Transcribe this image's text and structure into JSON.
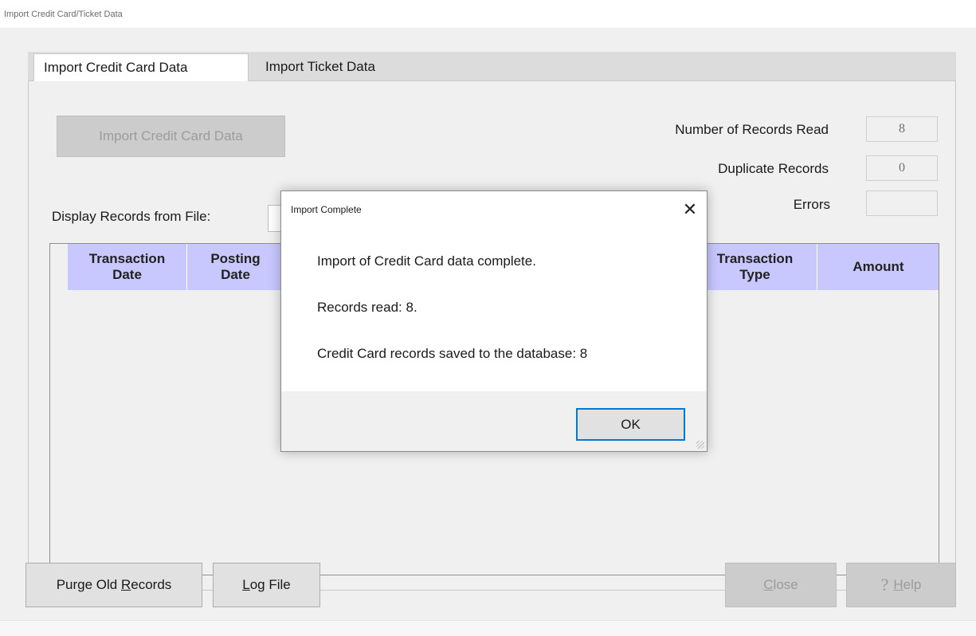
{
  "window": {
    "title": "Import Credit Card/Ticket Data"
  },
  "tabs": [
    {
      "label": "Import Credit Card Data",
      "active": true
    },
    {
      "label": "Import Ticket Data",
      "active": false
    }
  ],
  "panel": {
    "import_button_label": "Import Credit Card Data",
    "stats": {
      "records_read_label": "Number of Records Read",
      "records_read_value": "8",
      "duplicate_label": "Duplicate Records",
      "duplicate_value": "0",
      "errors_label": "Errors",
      "errors_value": ""
    },
    "display_records_label": "Display Records from File:",
    "grid": {
      "columns": [
        {
          "line1": "Transaction",
          "line2": "Date"
        },
        {
          "line1": "Posting",
          "line2": "Date"
        },
        {
          "line1": "Transaction",
          "line2": "Type"
        },
        {
          "line1": "Amount",
          "line2": ""
        }
      ],
      "rows": []
    }
  },
  "buttons": {
    "purge_prefix": "Purge Old ",
    "purge_mnemonic": "R",
    "purge_suffix": "ecords",
    "log_mnemonic": "L",
    "log_suffix": "og File",
    "close_mnemonic": "C",
    "close_suffix": "lose",
    "help_icon": "?",
    "help_mnemonic": "H",
    "help_suffix": "elp"
  },
  "dialog": {
    "title": "Import Complete",
    "close_glyph": "✕",
    "messages": [
      "Import of Credit Card data complete.",
      "Records read: 8.",
      "Credit Card records saved to the database: 8"
    ],
    "ok_label": "OK"
  },
  "colors": {
    "grid_header": "#c8c8ff",
    "ok_focus_border": "#0078d7",
    "window_bg": "#f0f0f0"
  }
}
